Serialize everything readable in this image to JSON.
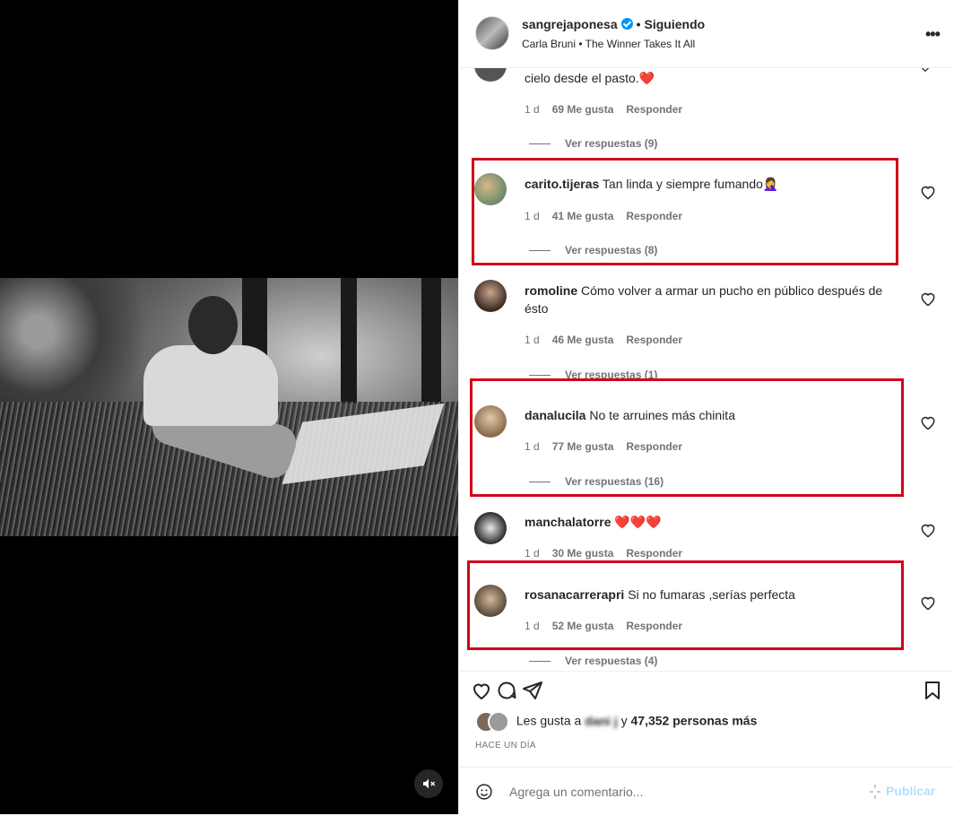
{
  "post": {
    "username": "sangrejaponesa",
    "follow_status": "Siguiendo",
    "audio": "Carla Bruni • The Winner Takes It All"
  },
  "comments": [
    {
      "username": "",
      "text": "cielo desde el pasto.❤️",
      "time": "1 d",
      "likes": "69 Me gusta",
      "reply": "Responder",
      "view_replies": "Ver respuestas (9)"
    },
    {
      "username": "carito.tijeras",
      "text": "Tan linda y siempre fumando🤦‍♀️",
      "time": "1 d",
      "likes": "41 Me gusta",
      "reply": "Responder",
      "view_replies": "Ver respuestas (8)"
    },
    {
      "username": "romoline",
      "text": "Cómo volver a armar un pucho en público después de ésto",
      "time": "1 d",
      "likes": "46 Me gusta",
      "reply": "Responder",
      "view_replies": "Ver respuestas (1)"
    },
    {
      "username": "danalucila",
      "text": "No te arruines más chinita",
      "time": "1 d",
      "likes": "77 Me gusta",
      "reply": "Responder",
      "view_replies": "Ver respuestas (16)"
    },
    {
      "username": "manchalatorre",
      "text": "❤️❤️❤️",
      "time": "1 d",
      "likes": "30 Me gusta",
      "reply": "Responder",
      "view_replies": ""
    },
    {
      "username": "rosanacarrerapri",
      "text": "Si no fumaras ,serías perfecta",
      "time": "1 d",
      "likes": "52 Me gusta",
      "reply": "Responder",
      "view_replies": "Ver respuestas (4)"
    }
  ],
  "likes": {
    "prefix": "Les gusta a",
    "redacted_user": "dani j",
    "suffix": "y",
    "count": "47,352 personas más"
  },
  "timestamp": "HACE UN DÍA",
  "add_comment": {
    "placeholder": "Agrega un comentario...",
    "publish_label": "Publicar"
  },
  "colors": {
    "highlight": "#d0021b",
    "heart": "#e0245e",
    "verified": "#0095f6",
    "publish_disabled": "#b2dffc"
  },
  "icons": [
    "verified-badge-icon",
    "more-options-icon",
    "heart-icon",
    "comment-icon",
    "share-icon",
    "bookmark-icon",
    "emoji-icon",
    "muted-speaker-icon",
    "chevron-down-icon"
  ]
}
